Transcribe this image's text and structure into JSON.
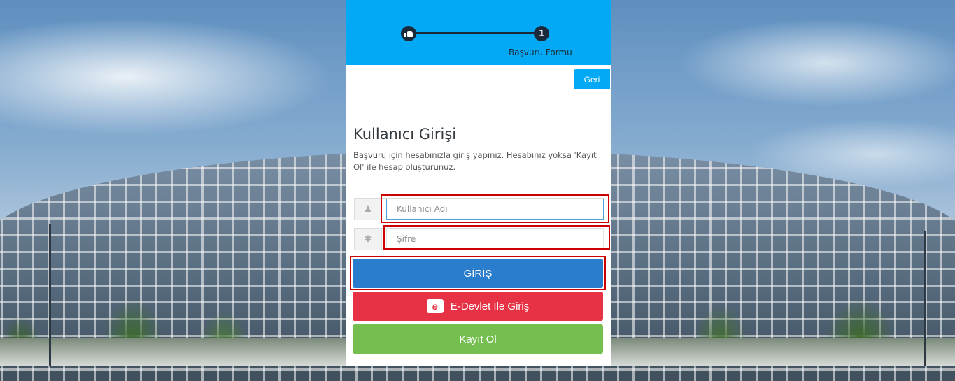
{
  "wizard": {
    "step_icon": "thumbs-up-icon",
    "step_number": "1",
    "step_label": "Başvuru Formu"
  },
  "back_button": "Geri",
  "login": {
    "title": "Kullanıcı Girişi",
    "description": "Başvuru için hesabınızla giriş yapınız. Hesabınız yoksa 'Kayıt Ol' ile hesap oluşturunuz.",
    "username_placeholder": "Kullanıcı Adı",
    "password_placeholder": "Şifre",
    "submit": "GİRİŞ",
    "edevlet": "E-Devlet İle Giriş",
    "register": "Kayıt Ol"
  },
  "colors": {
    "header": "#03a9f4",
    "submit": "#2a7ccc",
    "edevlet": "#e63244",
    "register": "#74bf4f",
    "highlight": "#cc0000"
  }
}
